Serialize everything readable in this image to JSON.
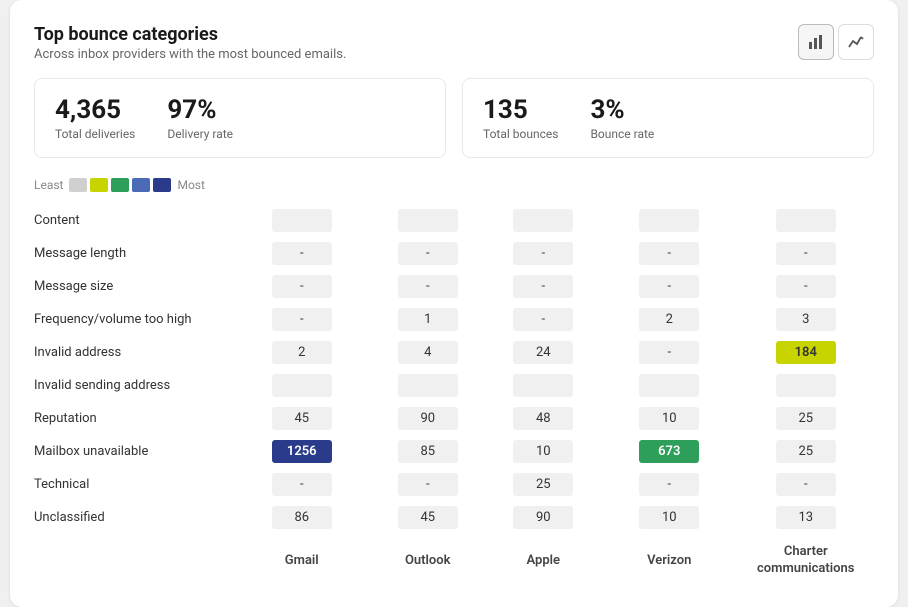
{
  "card": {
    "title": "Top bounce categories",
    "subtitle": "Across inbox providers with the most bounced emails."
  },
  "buttons": [
    {
      "label": "bar-chart",
      "active": true
    },
    {
      "label": "line-chart",
      "active": false
    }
  ],
  "stats": [
    {
      "items": [
        {
          "value": "4,365",
          "label": "Total deliveries"
        },
        {
          "value": "97%",
          "label": "Delivery rate"
        }
      ]
    },
    {
      "items": [
        {
          "value": "135",
          "label": "Total bounces"
        },
        {
          "value": "3%",
          "label": "Bounce rate"
        }
      ]
    }
  ],
  "legend": {
    "least_label": "Least",
    "most_label": "Most",
    "swatches": [
      "#d0d0d0",
      "#c8d400",
      "#2e9e5b",
      "#4a6ab5",
      "#2b3b8c"
    ]
  },
  "table": {
    "columns": [
      "",
      "Gmail",
      "Outlook",
      "Apple",
      "Verizon",
      "Charter\ncommunications"
    ],
    "rows": [
      {
        "category": "Content",
        "cells": [
          "",
          "",
          "",
          "",
          ""
        ]
      },
      {
        "category": "Message length",
        "cells": [
          "-",
          "-",
          "-",
          "-",
          "-"
        ]
      },
      {
        "category": "Message size",
        "cells": [
          "-",
          "-",
          "-",
          "-",
          "-"
        ]
      },
      {
        "category": "Frequency/volume too high",
        "cells": [
          "-",
          "1",
          "-",
          "2",
          "3"
        ]
      },
      {
        "category": "Invalid address",
        "cells": [
          "2",
          "4",
          "24",
          "-",
          "184"
        ]
      },
      {
        "category": "Invalid sending address",
        "cells": [
          "",
          "",
          "",
          "",
          ""
        ]
      },
      {
        "category": "Reputation",
        "cells": [
          "45",
          "90",
          "48",
          "10",
          "25"
        ]
      },
      {
        "category": "Mailbox unavailable",
        "cells": [
          "1256",
          "85",
          "10",
          "673",
          "25"
        ]
      },
      {
        "category": "Technical",
        "cells": [
          "-",
          "-",
          "25",
          "-",
          "-"
        ]
      },
      {
        "category": "Unclassified",
        "cells": [
          "86",
          "45",
          "90",
          "10",
          "13"
        ]
      }
    ],
    "highlight_rules": {
      "Mailbox unavailable_Gmail": "dark-blue",
      "Mailbox unavailable_Verizon": "green",
      "Invalid address_Charter\ncommunications": "yellow"
    }
  }
}
